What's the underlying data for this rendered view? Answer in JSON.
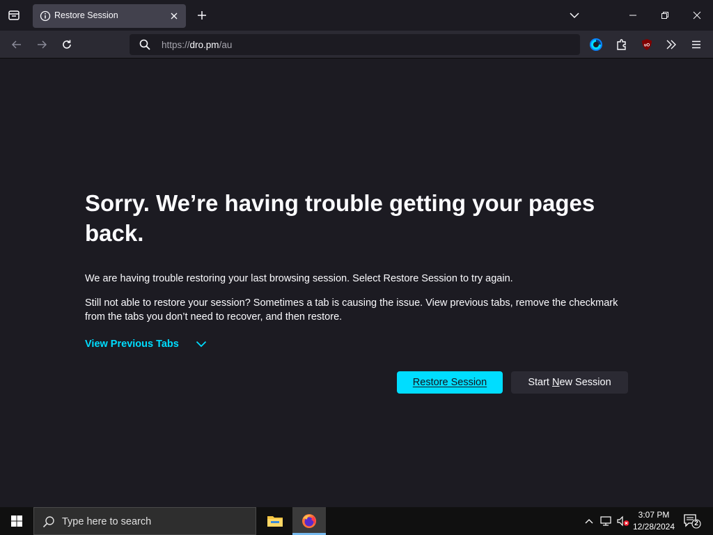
{
  "browser": {
    "tab": {
      "title": "Restore Session",
      "icon": "info-icon"
    },
    "url": {
      "scheme": "https://",
      "host": "dro.pm",
      "path": "/au"
    }
  },
  "content": {
    "heading": "Sorry. We’re having trouble getting your pages back.",
    "para1": "We are having trouble restoring your last browsing session. Select Restore Session to try again.",
    "para2": "Still not able to restore your session? Sometimes a tab is causing the issue. View previous tabs, remove the checkmark from the tabs you don’t need to recover, and then restore.",
    "view_previous_label": "View Previous Tabs",
    "restore_button": "Restore Session",
    "new_session_button_pre": "Start ",
    "new_session_button_u": "N",
    "new_session_button_post": "ew Session"
  },
  "taskbar": {
    "search_placeholder": "Type here to search",
    "time": "3:07 PM",
    "date": "12/28/2024",
    "notification_count": "2"
  },
  "colors": {
    "accent": "#00ddff",
    "background": "#1c1b22",
    "toolbar": "#2b2a33"
  }
}
